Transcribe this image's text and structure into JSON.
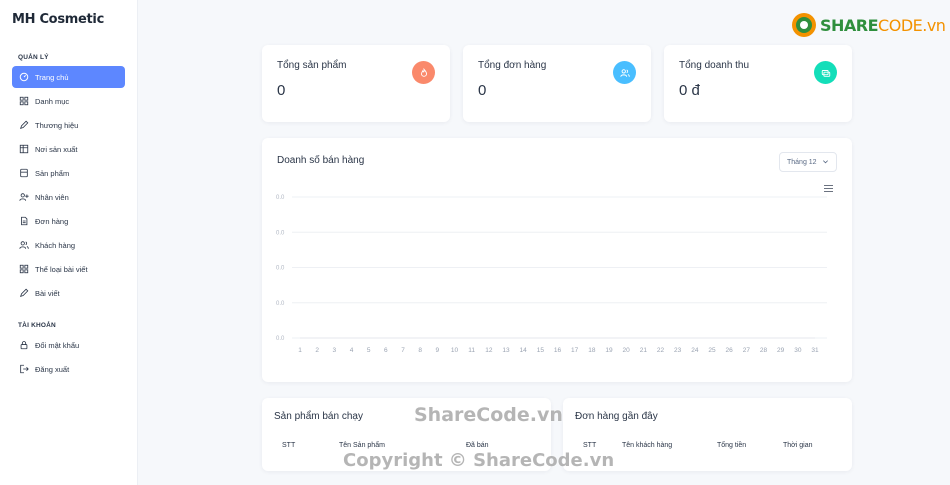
{
  "app": {
    "brand": "MH Cosmetic"
  },
  "sidebar": {
    "section_manage": "QUẢN LÝ",
    "section_account": "TÀI KHOẢN",
    "items": [
      {
        "label": "Trang chủ",
        "icon": "dashboard-icon",
        "active": true
      },
      {
        "label": "Danh mục",
        "icon": "grid-icon"
      },
      {
        "label": "Thương hiệu",
        "icon": "pencil-icon"
      },
      {
        "label": "Nơi sản xuất",
        "icon": "table-icon"
      },
      {
        "label": "Sản phẩm",
        "icon": "product-icon"
      },
      {
        "label": "Nhân viên",
        "icon": "user-plus-icon"
      },
      {
        "label": "Đơn hàng",
        "icon": "file-icon"
      },
      {
        "label": "Khách hàng",
        "icon": "users-icon"
      },
      {
        "label": "Thể loại bài viết",
        "icon": "grid-icon"
      },
      {
        "label": "Bài viết",
        "icon": "pencil-icon"
      }
    ],
    "account_items": [
      {
        "label": "Đổi mật khẩu",
        "icon": "lock-icon"
      },
      {
        "label": "Đăng xuất",
        "icon": "logout-icon"
      }
    ]
  },
  "stats": [
    {
      "title": "Tổng sản phẩm",
      "value": "0",
      "icon": "flame-icon",
      "color": "#fa896b"
    },
    {
      "title": "Tổng đơn hàng",
      "value": "0",
      "icon": "users-icon",
      "color": "#49beff"
    },
    {
      "title": "Tổng doanh thu",
      "value": "0 đ",
      "icon": "money-icon",
      "color": "#13deb9"
    }
  ],
  "sales_chart": {
    "title": "Doanh số bán hàng",
    "month_select": "Tháng 12",
    "chart_data": {
      "type": "line",
      "x": [
        "1",
        "2",
        "3",
        "4",
        "5",
        "6",
        "7",
        "8",
        "9",
        "10",
        "11",
        "12",
        "13",
        "14",
        "15",
        "16",
        "17",
        "18",
        "19",
        "20",
        "21",
        "22",
        "23",
        "24",
        "25",
        "26",
        "27",
        "28",
        "29",
        "30",
        "31"
      ],
      "series": [
        {
          "values": [
            0,
            0,
            0,
            0,
            0,
            0,
            0,
            0,
            0,
            0,
            0,
            0,
            0,
            0,
            0,
            0,
            0,
            0,
            0,
            0,
            0,
            0,
            0,
            0,
            0,
            0,
            0,
            0,
            0,
            0,
            0
          ]
        }
      ],
      "yticks": [
        "0.0",
        "0.0",
        "0.0",
        "0.0",
        "0.0"
      ],
      "grid": true
    }
  },
  "best_sellers": {
    "title": "Sản phẩm bán chạy",
    "columns": [
      "STT",
      "Tên Sản phẩm",
      "Đã bán"
    ]
  },
  "recent_orders": {
    "title": "Đơn hàng gần đây",
    "columns": [
      "STT",
      "Tên khách hàng",
      "Tổng tiền",
      "Thời gian"
    ]
  },
  "logo": {
    "part1": "SHARE",
    "part2": "CODE.vn"
  },
  "watermarks": {
    "center": "ShareCode.vn",
    "bottom": "Copyright © ShareCode.vn"
  }
}
